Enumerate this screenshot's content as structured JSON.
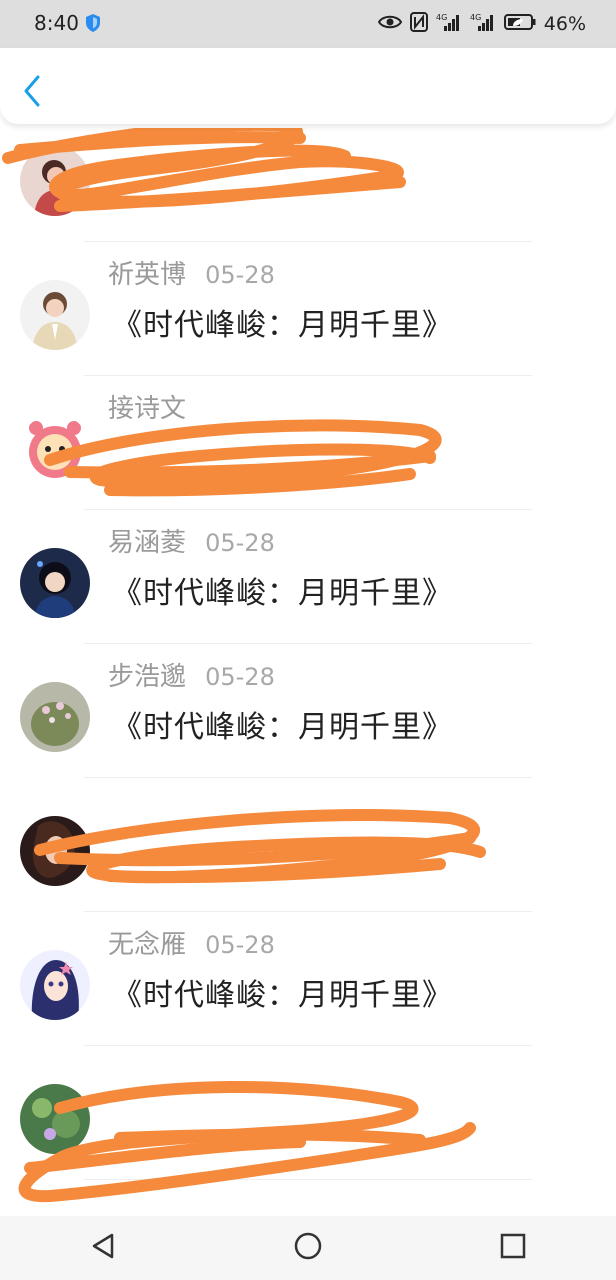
{
  "status_bar": {
    "time": "8:40",
    "battery": "46%",
    "icons": [
      "shield-icon",
      "eye-icon",
      "nfc-icon",
      "signal-4g-icon",
      "signal-4g-icon-2",
      "battery-icon"
    ]
  },
  "header": {
    "back_icon": "chevron-left-icon"
  },
  "colors": {
    "accent": "#1aa0e8",
    "scribble": "#f58a3c",
    "name": "#9a9a9a",
    "text": "#222222"
  },
  "items": [
    {
      "name": "",
      "date": "",
      "message": "",
      "redacted": true
    },
    {
      "name": "祈英博",
      "date": "05-28",
      "message": "《时代峰峻：月明千里》"
    },
    {
      "name": "接诗文",
      "date": "",
      "message": "",
      "redacted": true
    },
    {
      "name": "易涵菱",
      "date": "05-28",
      "message": "《时代峰峻：月明千里》"
    },
    {
      "name": "步浩邈",
      "date": "05-28",
      "message": "《时代峰峻：月明千里》"
    },
    {
      "name": "",
      "date": "",
      "message": "",
      "redacted": true
    },
    {
      "name": "无念雁",
      "date": "05-28",
      "message": "《时代峰峻：月明千里》"
    },
    {
      "name": "",
      "date": "",
      "message": "",
      "redacted": true
    },
    {
      "name": "",
      "date": "",
      "message": "",
      "redacted": false
    }
  ],
  "nav": [
    "back-triangle-icon",
    "home-circle-icon",
    "recents-square-icon"
  ]
}
